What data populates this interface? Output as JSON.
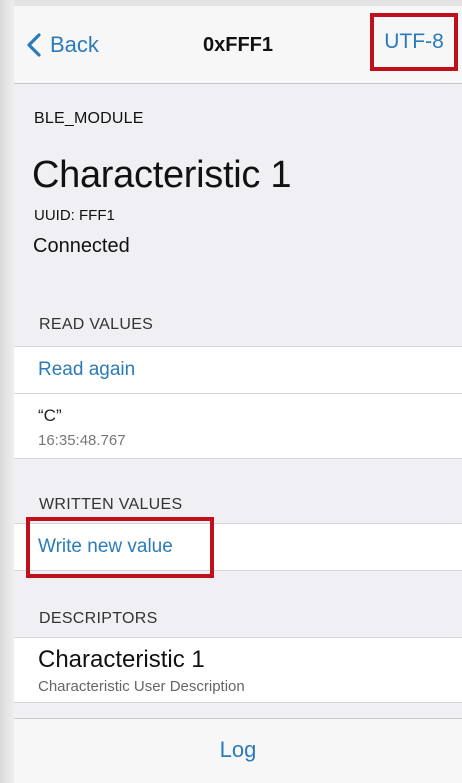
{
  "nav": {
    "back_label": "Back",
    "title": "0xFFF1",
    "encoding_label": "UTF-8"
  },
  "info": {
    "device_name": "BLE_MODULE",
    "characteristic_title": "Characteristic 1",
    "uuid": "UUID: FFF1",
    "status": "Connected"
  },
  "read_values": {
    "header": "READ VALUES",
    "action_label": "Read again",
    "value": "“C”",
    "timestamp": "16:35:48.767"
  },
  "written_values": {
    "header": "WRITTEN VALUES",
    "action_label": "Write new value"
  },
  "descriptors": {
    "header": "DESCRIPTORS",
    "items": [
      {
        "title": "Characteristic 1",
        "subtitle": "Characteristic User Description"
      }
    ]
  },
  "tabbar": {
    "log_label": "Log"
  },
  "colors": {
    "accent": "#2b7bb9",
    "highlight": "#c0101c"
  }
}
